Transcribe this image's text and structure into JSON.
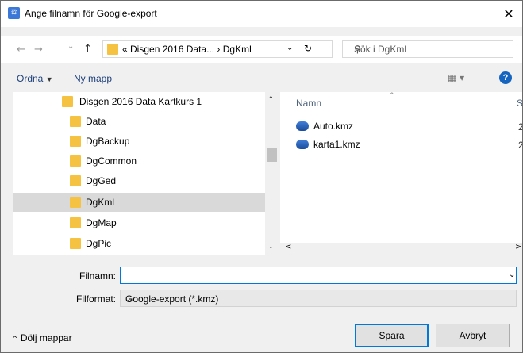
{
  "window": {
    "title": "Ange filnamn för Google-export",
    "close_label": "✕",
    "app_icon_glyph": "ఔ"
  },
  "address": {
    "back_glyph": "←",
    "forward_glyph": "→",
    "recent_glyph": "⌄",
    "up_glyph": "↑",
    "path": "« Disgen 2016 Data... › DgKml",
    "dropdown_glyph": "⌄",
    "refresh_glyph": "↻",
    "search_placeholder": "Sök i DgKml",
    "search_glyph": "⚲"
  },
  "toolbar": {
    "organize_label": "Ordna",
    "organize_caret": "▼",
    "new_folder_label": "Ny mapp",
    "view_glyph": "▦ ▾",
    "help_glyph": "?"
  },
  "tree": {
    "items": [
      {
        "label": "Disgen 2016 Data Kartkurs 1",
        "selected": false
      },
      {
        "label": "Data",
        "selected": false
      },
      {
        "label": "DgBackup",
        "selected": false
      },
      {
        "label": "DgCommon",
        "selected": false
      },
      {
        "label": "DgGed",
        "selected": false
      },
      {
        "label": "DgKml",
        "selected": true
      },
      {
        "label": "DgMap",
        "selected": false
      },
      {
        "label": "DgPic",
        "selected": false
      }
    ],
    "scroll_up_glyph": "⌃",
    "scroll_down_glyph": "⌄"
  },
  "files": {
    "column_name": "Namn",
    "column_second_initial": "S",
    "sort_glyph": "^",
    "rows": [
      {
        "name": "Auto.kmz",
        "extra": "2"
      },
      {
        "name": "karta1.kmz",
        "extra": "2"
      }
    ],
    "scroll_left_glyph": "<",
    "scroll_right_glyph": ">"
  },
  "form": {
    "filename_label": "Filnamn:",
    "filename_value": "",
    "filename_dd_glyph": "⌄",
    "format_label": "Filformat:",
    "format_value": "Google-export (*.kmz)",
    "format_dd_glyph": "⌄"
  },
  "footer": {
    "hide_folders_caret": "^",
    "hide_folders_label": "Dölj mappar",
    "save_label": "Spara",
    "cancel_label": "Avbryt"
  },
  "colors": {
    "accent": "#0078d7",
    "folder": "#f5c242",
    "selection": "#d9d9d9"
  }
}
